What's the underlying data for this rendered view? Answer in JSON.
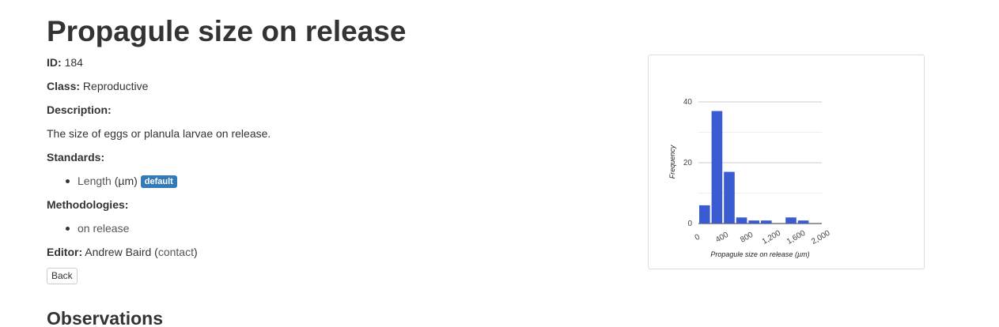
{
  "page": {
    "title": "Propagule size on release",
    "id_label": "ID:",
    "id_value": "184",
    "class_label": "Class:",
    "class_value": "Reproductive",
    "description_label": "Description:",
    "description_text": "The size of eggs or planula larvae on release.",
    "standards_label": "Standards:",
    "standards": [
      {
        "name": "Length",
        "unit": "(µm)",
        "badge": "default"
      }
    ],
    "methodologies_label": "Methodologies:",
    "methodologies": [
      "on release"
    ],
    "editor_label": "Editor:",
    "editor_name": "Andrew Baird",
    "editor_contact": "contact",
    "back_label": "Back",
    "observations_title": "Observations"
  },
  "colors": {
    "bar": "#3b5bd3",
    "badge": "#337ab7",
    "grid": "#cccccc"
  },
  "chart_data": {
    "type": "bar",
    "title": "",
    "xlabel": "Propagule size on release (µm)",
    "ylabel": "Frequency",
    "x_ticks": [
      "0",
      "400",
      "800",
      "1,200",
      "1,600",
      "2,000"
    ],
    "x_tick_values": [
      0,
      400,
      800,
      1200,
      1600,
      2000
    ],
    "y_ticks": [
      "0",
      "20",
      "40"
    ],
    "y_tick_values": [
      0,
      20,
      40
    ],
    "ylim": [
      0,
      40
    ],
    "xlim": [
      0,
      2000
    ],
    "bin_width": 200,
    "bins": [
      {
        "start": 0,
        "value": 6
      },
      {
        "start": 200,
        "value": 37
      },
      {
        "start": 400,
        "value": 17
      },
      {
        "start": 600,
        "value": 2
      },
      {
        "start": 800,
        "value": 1
      },
      {
        "start": 1000,
        "value": 1
      },
      {
        "start": 1200,
        "value": 0
      },
      {
        "start": 1400,
        "value": 2
      },
      {
        "start": 1600,
        "value": 1
      },
      {
        "start": 1800,
        "value": 0
      }
    ]
  }
}
